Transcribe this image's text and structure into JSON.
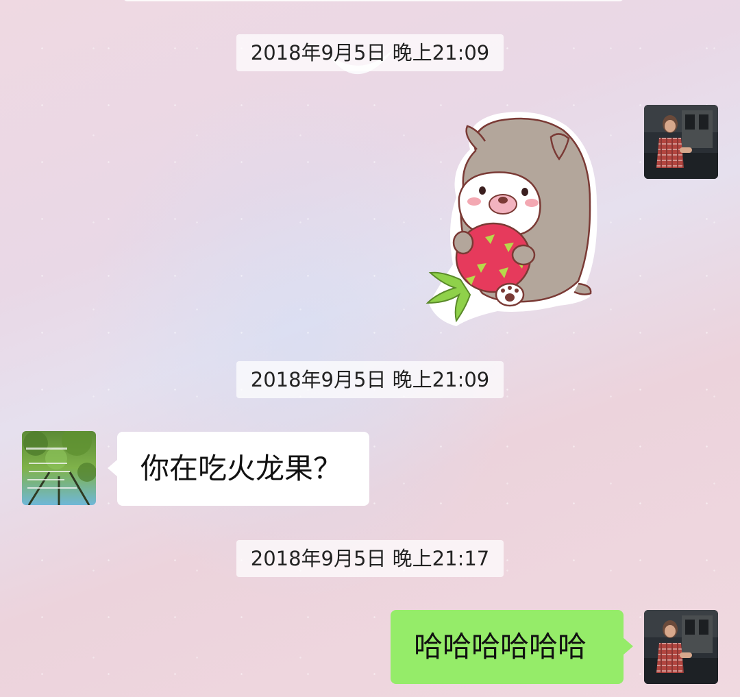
{
  "chat": {
    "messages": [
      {
        "timestamp": "2018年9月5日 晚上21:09",
        "sender": "me",
        "type": "sticker",
        "sticker": "bear-eating-dragon-fruit-sticker"
      },
      {
        "timestamp": "2018年9月5日 晚上21:09",
        "sender": "other",
        "type": "text",
        "text": "你在吃火龙果？"
      },
      {
        "timestamp": "2018年9月5日 晚上21:17",
        "sender": "me",
        "type": "text",
        "text": "哈哈哈哈哈哈"
      }
    ]
  },
  "colors": {
    "outgoing_bubble": "#95ec69",
    "incoming_bubble": "#ffffff",
    "timestamp_bg": "#ffffff"
  }
}
